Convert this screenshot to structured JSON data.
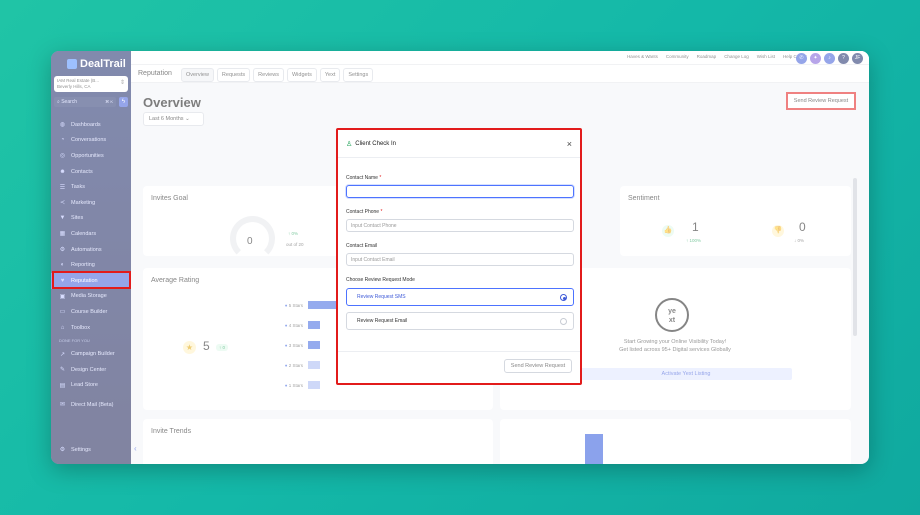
{
  "app": {
    "logo_text": "DealTrail"
  },
  "location": {
    "line1": "IAM Real Estate (B...",
    "line2": "Beverly Hills, CA"
  },
  "search": {
    "placeholder": "Search",
    "shortcut": "⌘ K"
  },
  "sidebar": {
    "items": [
      {
        "label": "Dashboards",
        "icon": "dashboard-icon"
      },
      {
        "label": "Conversations",
        "icon": "chat-icon"
      },
      {
        "label": "Opportunities",
        "icon": "funnel-icon"
      },
      {
        "label": "Contacts",
        "icon": "contacts-icon"
      },
      {
        "label": "Tasks",
        "icon": "tasks-icon"
      },
      {
        "label": "Marketing",
        "icon": "share-icon"
      },
      {
        "label": "Sites",
        "icon": "sites-icon"
      },
      {
        "label": "Calendars",
        "icon": "calendar-icon"
      },
      {
        "label": "Automations",
        "icon": "automation-icon"
      },
      {
        "label": "Reporting",
        "icon": "chart-icon"
      },
      {
        "label": "Reputation",
        "icon": "heart-icon",
        "active": true
      },
      {
        "label": "Media Storage",
        "icon": "media-icon"
      },
      {
        "label": "Course Builder",
        "icon": "course-icon"
      },
      {
        "label": "Toolbox",
        "icon": "toolbox-icon"
      }
    ],
    "section_label": "DONE FOR YOU",
    "extra_items": [
      {
        "label": "Campaign Builder",
        "icon": "campaign-icon"
      },
      {
        "label": "Design Center",
        "icon": "design-icon"
      },
      {
        "label": "Lead Store",
        "icon": "store-icon"
      },
      {
        "label": "Direct Mail (Beta)",
        "icon": "mail-icon"
      }
    ],
    "settings_label": "Settings"
  },
  "topbar": {
    "links": [
      "Haves & Wants",
      "Community",
      "Roadmap",
      "Change Log",
      "Wish List",
      "Help Center"
    ],
    "avatar_initials": "JF"
  },
  "subnav": {
    "title": "Reputation",
    "tabs": [
      "Overview",
      "Requests",
      "Reviews",
      "Widgets",
      "Yext",
      "Settings"
    ],
    "active_tab": "Overview"
  },
  "main": {
    "page_title": "Overview",
    "range_label": "Last 6 Months",
    "send_review_label": "Send Review Request",
    "invites_goal": {
      "title": "Invites Goal",
      "value": "0",
      "change": "↑ 0%",
      "out_of": "out of 20"
    },
    "sentiment": {
      "title": "Sentiment",
      "positive": "1",
      "positive_change": "↑ 100%",
      "negative": "0",
      "negative_change": "↓ 0%"
    },
    "average_rating": {
      "title": "Average Rating",
      "value": "5",
      "change": "↑ 0",
      "bars": [
        {
          "label": "5 Stars",
          "fill": 1.0
        },
        {
          "label": "4 Stars",
          "fill": 0.15
        },
        {
          "label": "3 Stars",
          "fill": 0.15
        },
        {
          "label": "2 Stars",
          "fill": 0.15
        },
        {
          "label": "1 Stars",
          "fill": 0.15
        }
      ]
    },
    "yext": {
      "logo_line1": "ye",
      "logo_line2": "xt",
      "line1": "Start Growing your Online Visibility Today!",
      "line2": "Get listed across 95+ Digital services Globally",
      "button": "Activate Yext Listing"
    },
    "invite_trends": {
      "title": "Invite Trends"
    }
  },
  "modal": {
    "title": "Client Check In",
    "contact_name_label": "Contact Name",
    "contact_phone_label": "Contact Phone",
    "contact_phone_placeholder": "Input Contact Phone",
    "contact_email_label": "Contact Email",
    "contact_email_placeholder": "Input Contact Email",
    "mode_label": "Choose Review Request Mode",
    "mode_options": [
      "Review Request SMS",
      "Review Request Email"
    ],
    "selected_mode": "Review Request SMS",
    "required_mark": "*",
    "send_button": "Send Review Request"
  },
  "colors": {
    "accent": "#3f5bd8",
    "highlight": "#e21b1b",
    "success": "#22a35a"
  }
}
